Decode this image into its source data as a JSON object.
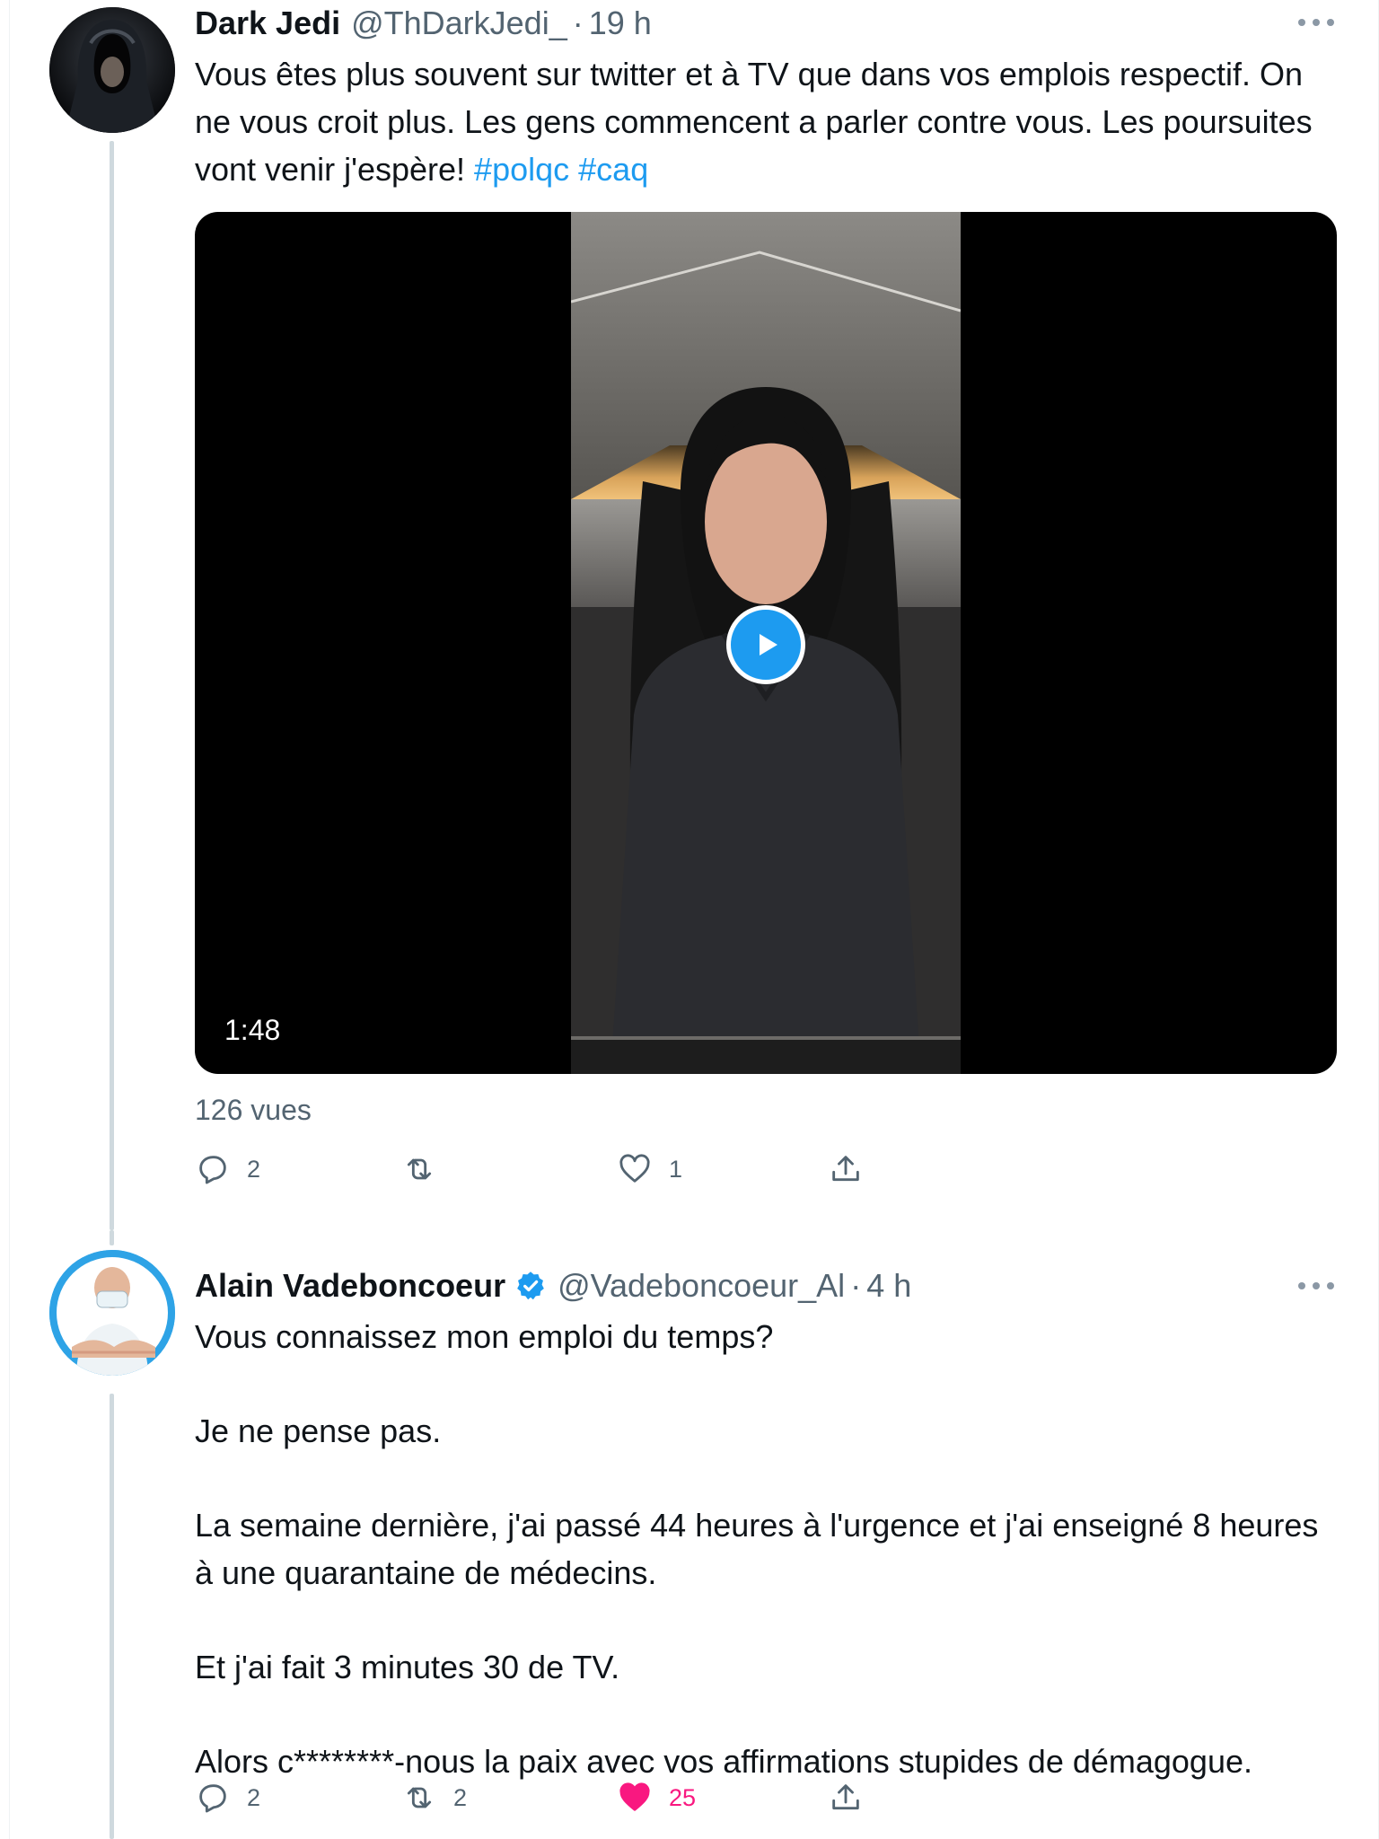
{
  "tweets": [
    {
      "name": "Dark Jedi",
      "handle": "@ThDarkJedi_",
      "separator": "·",
      "time": "19 h",
      "text_plain": "Vous êtes plus souvent sur twitter et à TV que dans vos emplois respectif. On ne vous croit plus. Les gens commencent a parler contre vous. Les poursuites vont venir j'espère!",
      "hashtags": [
        "#polqc",
        "#caq"
      ],
      "video_duration": "1:48",
      "views": "126 vues",
      "replies": "2",
      "retweets": "",
      "likes": "1"
    },
    {
      "name": "Alain Vadeboncoeur",
      "handle": "@Vadeboncoeur_Al",
      "separator": "·",
      "time": "4 h",
      "verified": true,
      "paragraphs": [
        "Vous connaissez mon emploi du temps?",
        "Je ne pense pas.",
        "La semaine dernière, j'ai passé 44 heures à l'urgence et j'ai enseigné 8 heures à une quarantaine de médecins.",
        "Et j'ai fait 3 minutes 30 de TV.",
        "Alors c********-nous la paix avec vos affirmations stupides de démagogue."
      ],
      "replies": "2",
      "retweets": "2",
      "likes": "25",
      "liked": true
    }
  ],
  "colors": {
    "link": "#1d9bf0",
    "muted": "#536471",
    "like_active": "#f91880",
    "text": "#0f1419"
  },
  "icons": {
    "more": "more-dots-icon",
    "reply": "reply-icon",
    "retweet": "retweet-icon",
    "like": "heart-icon",
    "share": "share-icon",
    "verified": "verified-badge-icon",
    "play": "play-icon"
  }
}
